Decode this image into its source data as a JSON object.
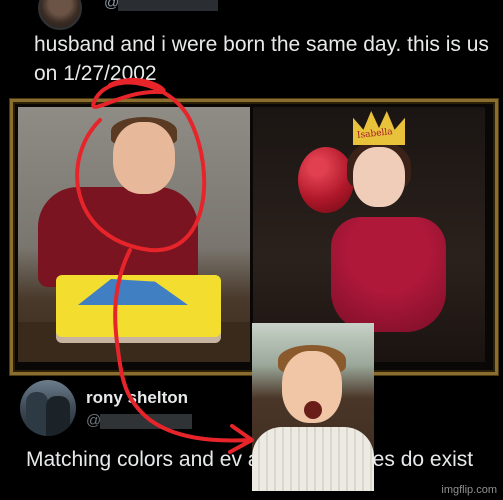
{
  "top_tweet": {
    "handle": "@j",
    "text": "husband and i were born the same day. this is us on 1/27/2002"
  },
  "photos": {
    "right_crown_text": "Isabella"
  },
  "reply": {
    "name": "rony shelton",
    "handle": "@",
    "text": "Matching colors and ev       aybe soulmates do exist"
  },
  "watermark": "imgflip.com",
  "colors": {
    "background": "#000000",
    "scribble": "#e8242b",
    "frame_gold": "#8a6d2f"
  }
}
